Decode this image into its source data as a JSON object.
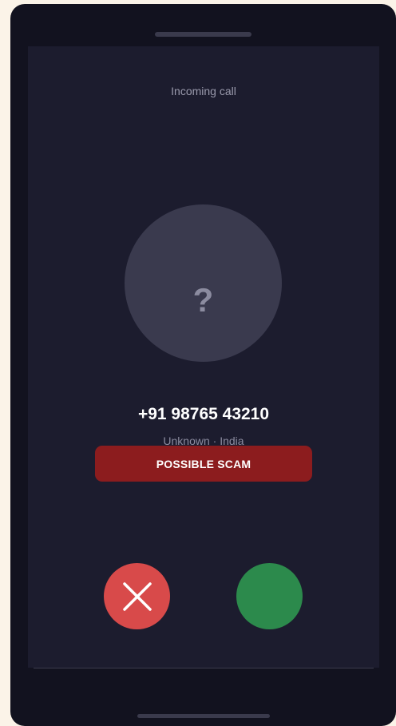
{
  "call": {
    "status": "Incoming call",
    "avatar_glyph": "?",
    "number": "+91 98765 43210",
    "meta": "Unknown · India",
    "warning": "POSSIBLE SCAM"
  },
  "actions": {
    "decline_icon": "close-icon",
    "accept_icon": "none"
  },
  "colors": {
    "screen_bg": "#1c1c2e",
    "decline": "#d84a4a",
    "accept": "#2c8a4c",
    "warning_bg": "#8c1c1e"
  }
}
